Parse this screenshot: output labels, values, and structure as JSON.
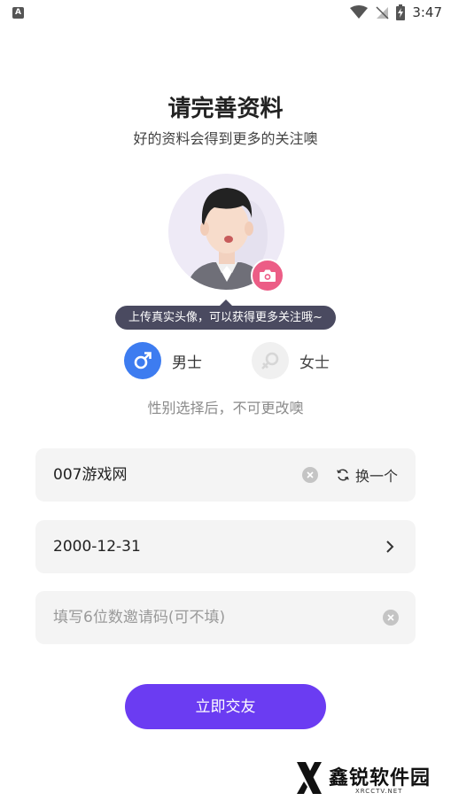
{
  "status_bar": {
    "app_badge": "A",
    "time": "3:47",
    "icons": [
      "wifi-icon",
      "no-signal-icon",
      "battery-charging-icon"
    ]
  },
  "header": {
    "title": "请完善资料",
    "subtitle": "好的资料会得到更多的关注噢"
  },
  "avatar": {
    "tooltip": "上传真实头像，可以获得更多关注哦~"
  },
  "gender": {
    "male_label": "男士",
    "female_label": "女士",
    "selected": "male",
    "note": "性别选择后，不可更改噢"
  },
  "form": {
    "nickname_value": "007游戏网",
    "refresh_label": "换一个",
    "birthday_value": "2000-12-31",
    "invite_placeholder": "填写6位数邀请码(可不填)"
  },
  "submit_label": "立即交友",
  "watermark": {
    "text": "鑫锐软件园",
    "sub": "XRCCTV.NET"
  },
  "colors": {
    "accent_purple": "#6b3cf2",
    "male_blue": "#3d7cf0",
    "camera_pink": "#ec5d86",
    "tooltip_bg": "#4a4a60",
    "field_bg": "#f4f4f4"
  }
}
